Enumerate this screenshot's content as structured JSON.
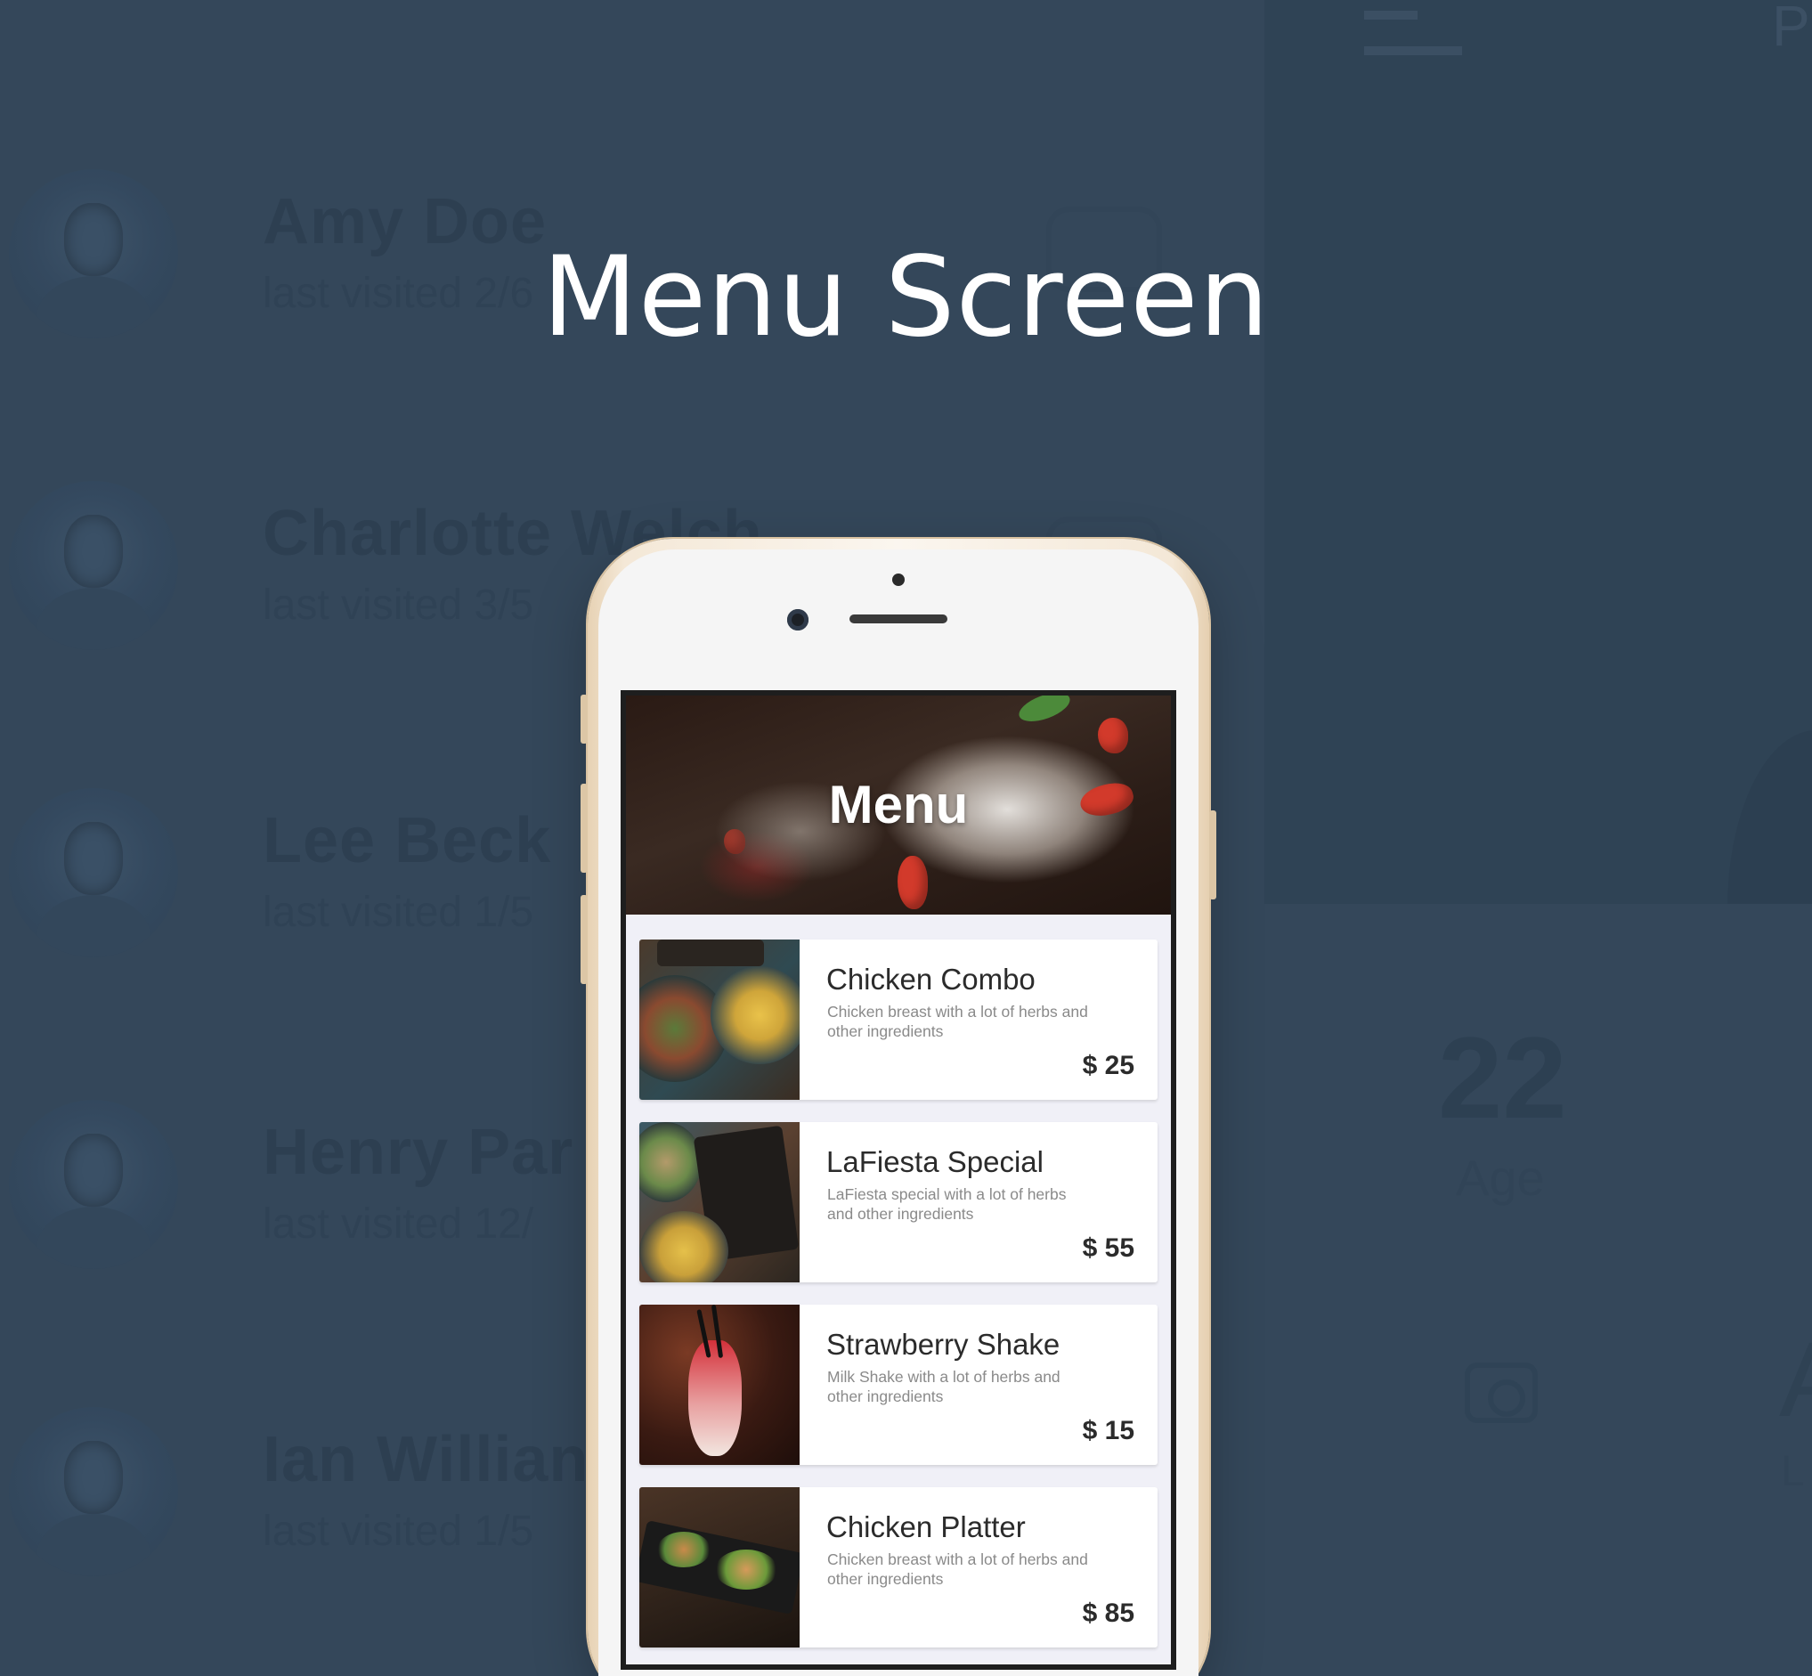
{
  "page_title": "Menu Screen",
  "background_contacts": [
    {
      "name": "Amy Doe",
      "visited": "last visited 2/6"
    },
    {
      "name": "Charlotte Welch",
      "visited": "last visited 3/5"
    },
    {
      "name": "Lee Beck",
      "visited": "last visited 1/5"
    },
    {
      "name": "Henry Par",
      "visited": "last visited 12/"
    },
    {
      "name": "Ian Willian",
      "visited": "last visited 1/5"
    }
  ],
  "background_profile": {
    "age_value": "22",
    "age_label": "Age",
    "corner_letter": "P",
    "side_letter": "A",
    "side_small": "L"
  },
  "app": {
    "header_title": "Menu",
    "items": [
      {
        "name": "Chicken Combo",
        "description": "Chicken breast with a lot of herbs and other ingredients",
        "price": "$ 25"
      },
      {
        "name": "LaFiesta Special",
        "description": "LaFiesta special with a lot of herbs and other ingredients",
        "price": "$ 55"
      },
      {
        "name": "Strawberry Shake",
        "description": "Milk Shake with a lot of herbs and other ingredients",
        "price": "$ 15"
      },
      {
        "name": "Chicken Platter",
        "description": "Chicken breast with a lot of herbs and other ingredients",
        "price": "$ 85"
      }
    ]
  },
  "colors": {
    "background": "#34475a",
    "title_text": "#ffffff",
    "card_background": "#ffffff",
    "list_background": "#f0f0f7",
    "phone_gold": "#e7d2b4"
  }
}
